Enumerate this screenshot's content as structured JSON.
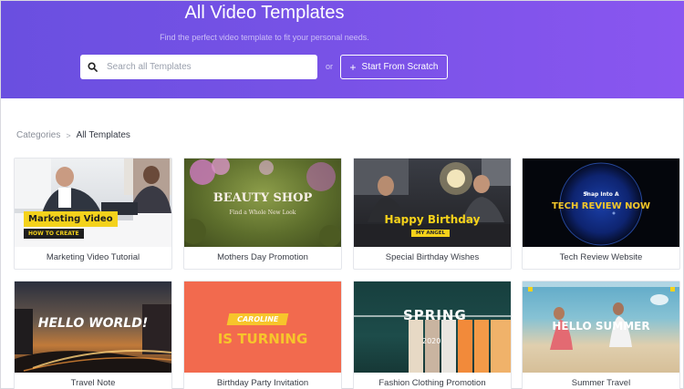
{
  "hero": {
    "title": "All Video Templates",
    "subtitle": "Find the perfect video template to fit your personal needs.",
    "search_placeholder": "Search all Templates",
    "or_text": "or",
    "scratch_label": "Start From Scratch",
    "scratch_icon": "plus-icon",
    "search_icon": "search-icon"
  },
  "breadcrumb": {
    "root": "Categories",
    "separator": ">",
    "current": "All Templates"
  },
  "colors": {
    "hero_gradient_start": "#6a4fe0",
    "hero_gradient_end": "#8a56f0"
  },
  "templates": [
    {
      "label": "Marketing Video Tutorial",
      "overlay_main": "Marketing Video",
      "overlay_sub": "HOW TO CREATE"
    },
    {
      "label": "Mothers Day Promotion",
      "overlay_main": "BEAUTY SHOP",
      "overlay_sub": "Find a Whole New Look"
    },
    {
      "label": "Special Birthday Wishes",
      "overlay_main": "Happy Birthday",
      "overlay_sub": "MY ANGEL"
    },
    {
      "label": "Tech Review Website",
      "overlay_sub": "Snap Into A",
      "overlay_main": "TECH REVIEW NOW"
    },
    {
      "label": "Travel Note",
      "overlay_main": "HELLO WORLD!"
    },
    {
      "label": "Birthday Party Invitation",
      "overlay_sub": "CAROLINE",
      "overlay_main": "IS TURNING"
    },
    {
      "label": "Fashion Clothing Promotion",
      "overlay_main": "SPRING",
      "overlay_sub": "2020"
    },
    {
      "label": "Summer Travel",
      "overlay_main": "HELLO SUMMER"
    }
  ]
}
